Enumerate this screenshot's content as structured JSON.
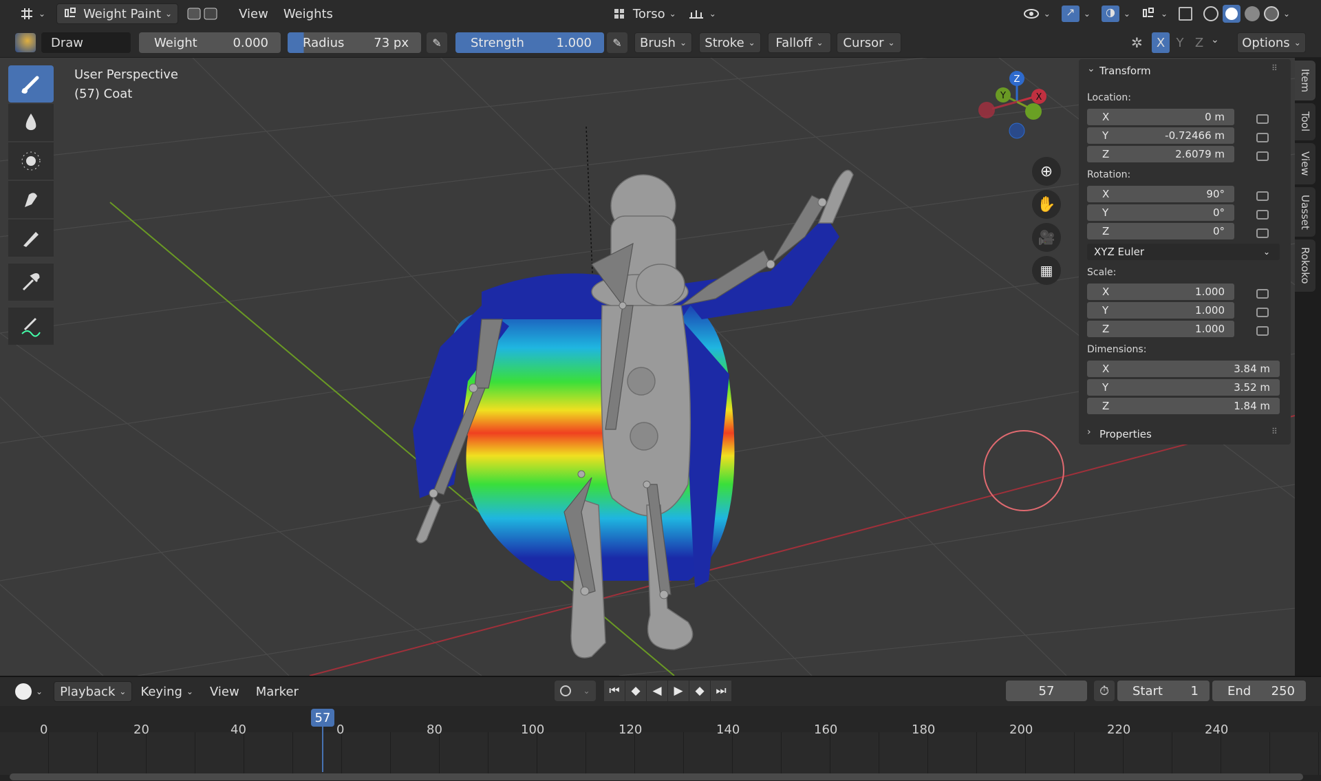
{
  "header": {
    "editor_icon": "editor-type-icon",
    "mode": "Weight Paint",
    "menus": [
      "View",
      "Weights"
    ],
    "vertex_group": "Torso",
    "options_label": "Options",
    "axis": [
      "X",
      "Y",
      "Z"
    ]
  },
  "tool_settings": {
    "brush_name": "Draw",
    "weight_label": "Weight",
    "weight_value": "0.000",
    "radius_label": "Radius",
    "radius_value": "73 px",
    "strength_label": "Strength",
    "strength_value": "1.000",
    "menus": [
      "Brush",
      "Stroke",
      "Falloff",
      "Cursor"
    ]
  },
  "viewport": {
    "perspective": "User Perspective",
    "object_info": "(57) Coat",
    "gizmo": {
      "x": "X",
      "y": "Y",
      "z": "Z"
    }
  },
  "toolbar": {
    "tools": [
      "brush-draw-icon",
      "blur-drop-icon",
      "average-icon",
      "smear-icon",
      "gradient-icon",
      "sample-eyedropper-icon",
      "annotate-icon"
    ]
  },
  "npanel": {
    "transform_title": "Transform",
    "location_label": "Location:",
    "location": [
      {
        "axis": "X",
        "value": "0 m"
      },
      {
        "axis": "Y",
        "value": "-0.72466 m"
      },
      {
        "axis": "Z",
        "value": "2.6079 m"
      }
    ],
    "rotation_label": "Rotation:",
    "rotation": [
      {
        "axis": "X",
        "value": "90°"
      },
      {
        "axis": "Y",
        "value": "0°"
      },
      {
        "axis": "Z",
        "value": "0°"
      }
    ],
    "rotation_mode": "XYZ Euler",
    "scale_label": "Scale:",
    "scale": [
      {
        "axis": "X",
        "value": "1.000"
      },
      {
        "axis": "Y",
        "value": "1.000"
      },
      {
        "axis": "Z",
        "value": "1.000"
      }
    ],
    "dimensions_label": "Dimensions:",
    "dimensions": [
      {
        "axis": "X",
        "value": "3.84 m"
      },
      {
        "axis": "Y",
        "value": "3.52 m"
      },
      {
        "axis": "Z",
        "value": "1.84 m"
      }
    ],
    "properties_title": "Properties",
    "tabs": [
      "Item",
      "Tool",
      "View",
      "Uasset",
      "Rokoko"
    ]
  },
  "timeline": {
    "menus": [
      "Playback",
      "Keying",
      "View",
      "Marker"
    ],
    "current_frame": "57",
    "start_label": "Start",
    "start_value": "1",
    "end_label": "End",
    "end_value": "250",
    "ticks": [
      "0",
      "20",
      "40",
      "57",
      "80",
      "100",
      "120",
      "140",
      "160",
      "180",
      "200",
      "220",
      "240"
    ],
    "playhead": "57"
  },
  "colors": {
    "accent": "#4772b3",
    "grid": "#3b3b3b",
    "x_axis": "#a0303a",
    "y_axis": "#6a9a24"
  }
}
